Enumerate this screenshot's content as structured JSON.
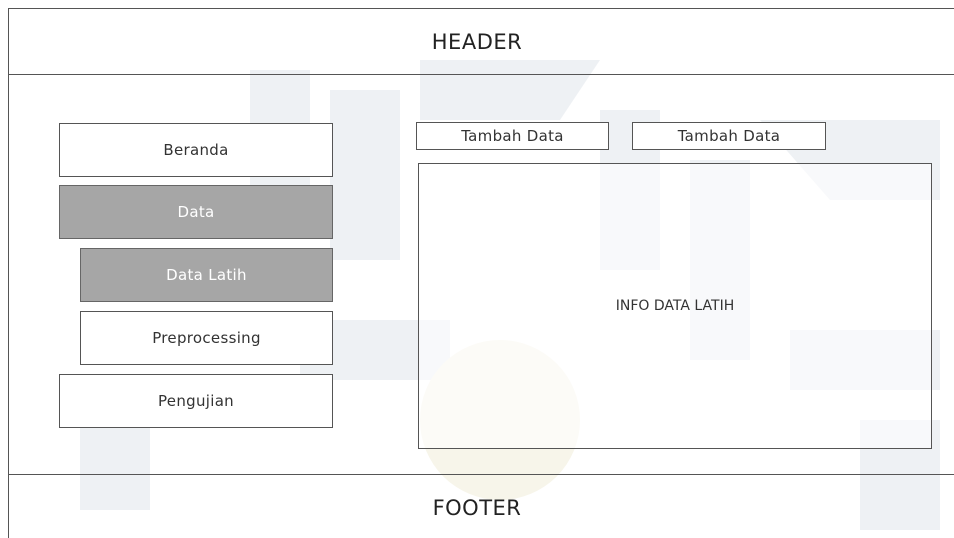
{
  "header": {
    "title": "HEADER"
  },
  "footer": {
    "title": "FOOTER"
  },
  "sidebar": {
    "items": [
      {
        "label": "Beranda",
        "active": false
      },
      {
        "label": "Data",
        "active": true
      },
      {
        "label": "Data Latih",
        "active": true
      },
      {
        "label": "Preprocessing",
        "active": false
      },
      {
        "label": "Pengujian",
        "active": false
      }
    ]
  },
  "toolbar": {
    "button1_label": "Tambah Data",
    "button2_label": "Tambah Data"
  },
  "main": {
    "content_label": "INFO DATA LATIH"
  },
  "colors": {
    "active_fill": "#a6a6a6",
    "border": "#555555",
    "watermark": "#eef1f4"
  }
}
